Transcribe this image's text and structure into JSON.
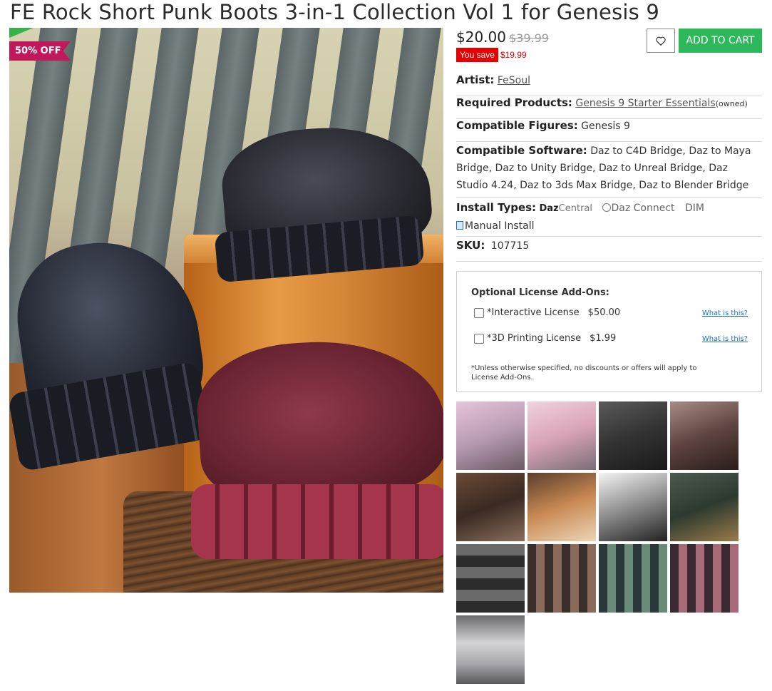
{
  "page": {
    "title": "FE Rock Short Punk Boots 3-in-1 Collection Vol 1 for Genesis 9"
  },
  "badge": {
    "label": "50% OFF",
    "color": "#c2185b"
  },
  "pricing": {
    "price": "$20.00",
    "old_price": "$39.99",
    "you_save_label": "You save",
    "you_save_amount": "$19.99"
  },
  "actions": {
    "wishlist_icon": "heart-outline-icon",
    "add_to_cart_label": "ADD TO CART",
    "add_to_cart_color": "#2eb85c"
  },
  "details": {
    "artist_label": "Artist:",
    "artist_value": "FeSoul",
    "required_label": "Required Products:",
    "required_value": "Genesis 9 Starter Essentials",
    "required_note": "(owned)",
    "figures_label": "Compatible Figures:",
    "figures_value": "Genesis 9",
    "software_label": "Compatible Software:",
    "software_value": "Daz to C4D Bridge, Daz to Maya Bridge, Daz to Unity Bridge, Daz to Unreal Bridge, Daz Studio 4.24, Daz to 3ds Max Bridge, Daz to Blender Bridge",
    "install_label": "Install Types:",
    "install_dazcentral_bold": "Daz",
    "install_dazcentral_light": "Central",
    "install_dazconnect": "Daz Connect",
    "install_dim": "DIM",
    "install_manual": "Manual Install",
    "sku_label": "SKU:",
    "sku_value": "107715"
  },
  "license": {
    "title": "Optional License Add-Ons:",
    "options": [
      {
        "label": "*Interactive License",
        "price": "$50.00",
        "help": "What is this?"
      },
      {
        "label": "*3D Printing License",
        "price": "$1.99",
        "help": "What is this?"
      }
    ],
    "note": "*Unless otherwise specified, no discounts or offers will apply to License Add-Ons."
  }
}
